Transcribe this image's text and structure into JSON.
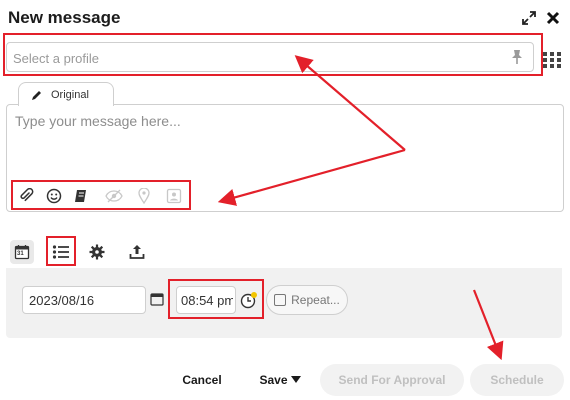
{
  "dialog": {
    "title": "New message"
  },
  "profile": {
    "placeholder": "Select a profile"
  },
  "editor": {
    "tab_label": "Original",
    "placeholder": "Type your message here..."
  },
  "calendar": {
    "day": "31"
  },
  "schedule": {
    "date_value": "2023/08/16",
    "time_value": "08:54 pm",
    "repeat_label": "Repeat..."
  },
  "footer": {
    "cancel_label": "Cancel",
    "save_label": "Save",
    "approval_label": "Send For Approval",
    "schedule_label": "Schedule"
  },
  "colors": {
    "annotation_red": "#e3202a",
    "disabled_text": "#c0c0c0"
  }
}
